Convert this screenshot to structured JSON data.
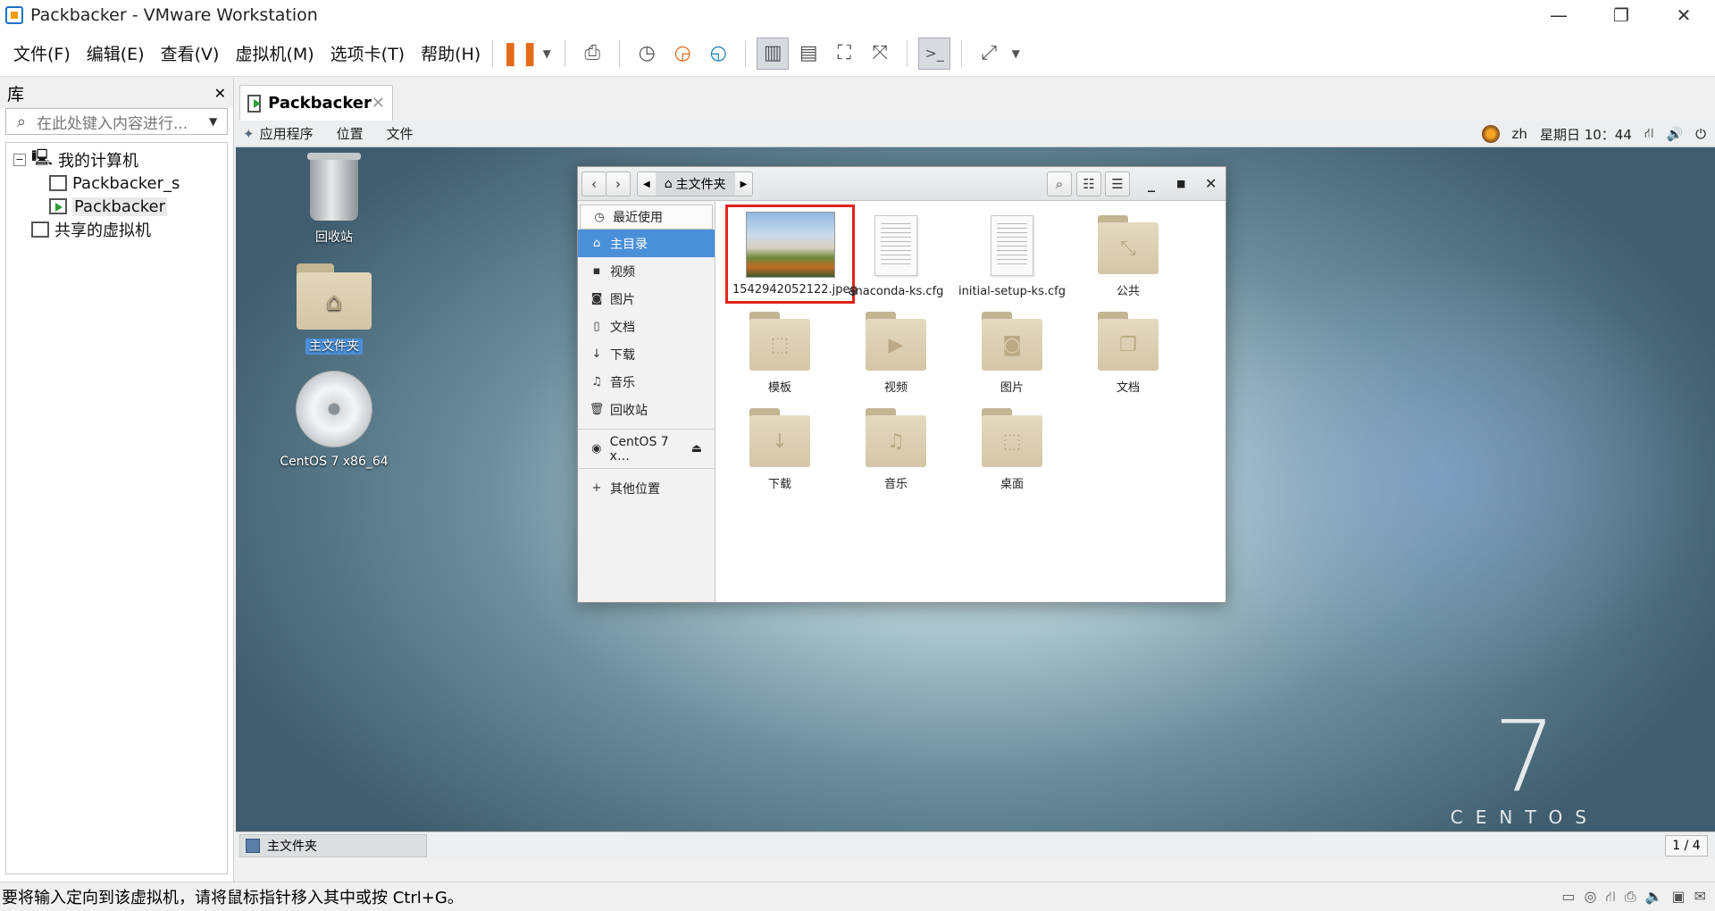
{
  "window": {
    "title": "Packbacker - VMware Workstation",
    "controls": {
      "minimize": "—",
      "restore": "❐",
      "close": "✕"
    }
  },
  "menu": [
    "文件(F)",
    "编辑(E)",
    "查看(V)",
    "虚拟机(M)",
    "选项卡(T)",
    "帮助(H)"
  ],
  "library": {
    "title": "库",
    "close": "✕",
    "search_placeholder": "在此处键入内容进行...",
    "tree": {
      "my_computer": "我的计算机",
      "items": [
        "Packbacker_s",
        "Packbacker"
      ],
      "shared": "共享的虚拟机",
      "expander": "−"
    }
  },
  "tab": {
    "label": "Packbacker",
    "close": "✕"
  },
  "guest": {
    "top_menu": [
      "应用程序",
      "位置",
      "文件"
    ],
    "lang": "zh",
    "clock": "星期日 10：44",
    "desktop_icons": {
      "trash": "回收站",
      "home": "主文件夹",
      "cd": "CentOS 7 x86_64"
    },
    "centos": {
      "version": "7",
      "word": "CENTOS"
    },
    "file_manager": {
      "breadcrumb": "主文件夹",
      "sidebar": {
        "recent": "最近使用",
        "home": "主目录",
        "videos": "视频",
        "pictures": "图片",
        "documents": "文档",
        "downloads": "下载",
        "music": "音乐",
        "trash": "回收站",
        "device": "CentOS 7 x…",
        "other": "其他位置"
      },
      "files": {
        "jpeg": "1542942052122.jpeg",
        "anaconda": "anaconda-ks.cfg",
        "initial": "initial-setup-ks.cfg",
        "public": "公共",
        "templates": "模板",
        "videos": "视频",
        "pictures": "图片",
        "documents": "文档",
        "downloads": "下载",
        "music": "音乐",
        "desktop": "桌面"
      }
    },
    "taskbar": {
      "task": "主文件夹",
      "pager": "1 / 4"
    }
  },
  "status": {
    "hint": "要将输入定向到该虚拟机，请将鼠标指针移入其中或按 Ctrl+G。"
  },
  "colors": {
    "selection": "#4a90d9",
    "highlight_box": "#e2231a",
    "pause": "#e26a1a"
  }
}
